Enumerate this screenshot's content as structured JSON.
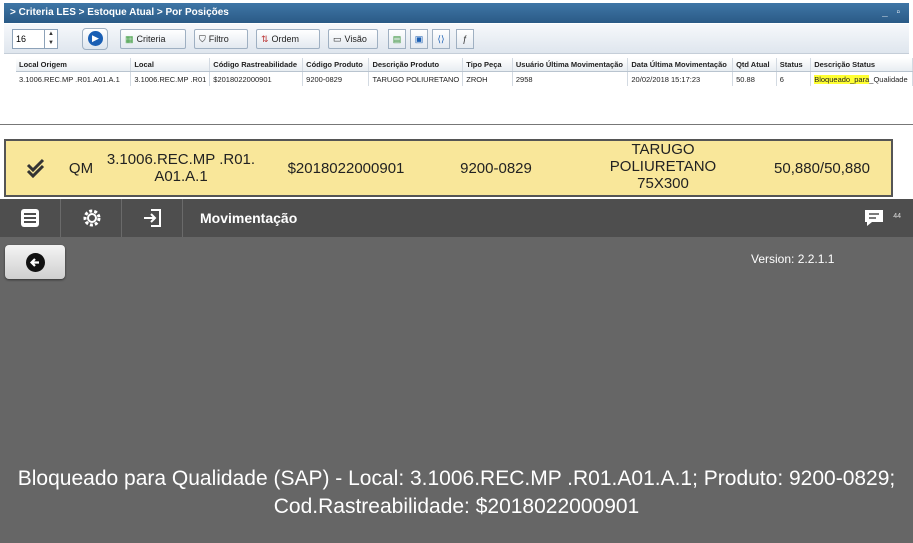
{
  "web": {
    "breadcrumb": "> Criteria LES > Estoque Atual > Por Posições",
    "window_controls": "_ ▫",
    "page_size": "16",
    "buttons": {
      "criteria": "Criteria",
      "filtro": "Filtro",
      "ordem": "Ordem",
      "visao": "Visão"
    },
    "columns": [
      "Local Origem",
      "Local",
      "Código Rastreabilidade",
      "Código Produto",
      "Descrição Produto",
      "Tipo Peça",
      "Usuário Última Movimentação",
      "Data Última Movimentação",
      "Qtd Atual",
      "Status",
      "Descrição Status"
    ],
    "row": {
      "local_origem": "3.1006.REC.MP .R01.A01.A.1",
      "local": "3.1006.REC.MP .R01",
      "codigo_rastreabilidade": "$2018022000901",
      "codigo_produto": "9200-0829",
      "descricao_produto": "TARUGO POLIURETANO",
      "tipo_peca": "ZROH",
      "usuario": "2958",
      "data": "20/02/2018 15:17:23",
      "qtd": "50.88",
      "status": "6",
      "descricao_status_hl": "Bloqueado_para",
      "descricao_status_rest": "_Qualidade"
    },
    "highlight_color": "#ffff33"
  },
  "item_row": {
    "type": "QM",
    "location": "3.1006.REC.MP .R01. A01.A.1",
    "code": "$2018022000901",
    "product": "9200-0829",
    "description": "TARUGO POLIURETANO 75X300",
    "quantity": "50,880/50,880",
    "bg_color": "#f9e79a"
  },
  "app": {
    "title": "Movimentação",
    "badge": "44",
    "version": "Version: 2.2.1.1",
    "message": "Bloqueado para Qualidade (SAP) - Local: 3.1006.REC.MP .R01.A01.A.1; Produto: 9200-0829; Cod.Rastreabilidade: $2018022000901",
    "icons": [
      "menu-icon",
      "settings-gear-icon",
      "login-icon",
      "message-icon",
      "back-arrow-icon"
    ]
  }
}
